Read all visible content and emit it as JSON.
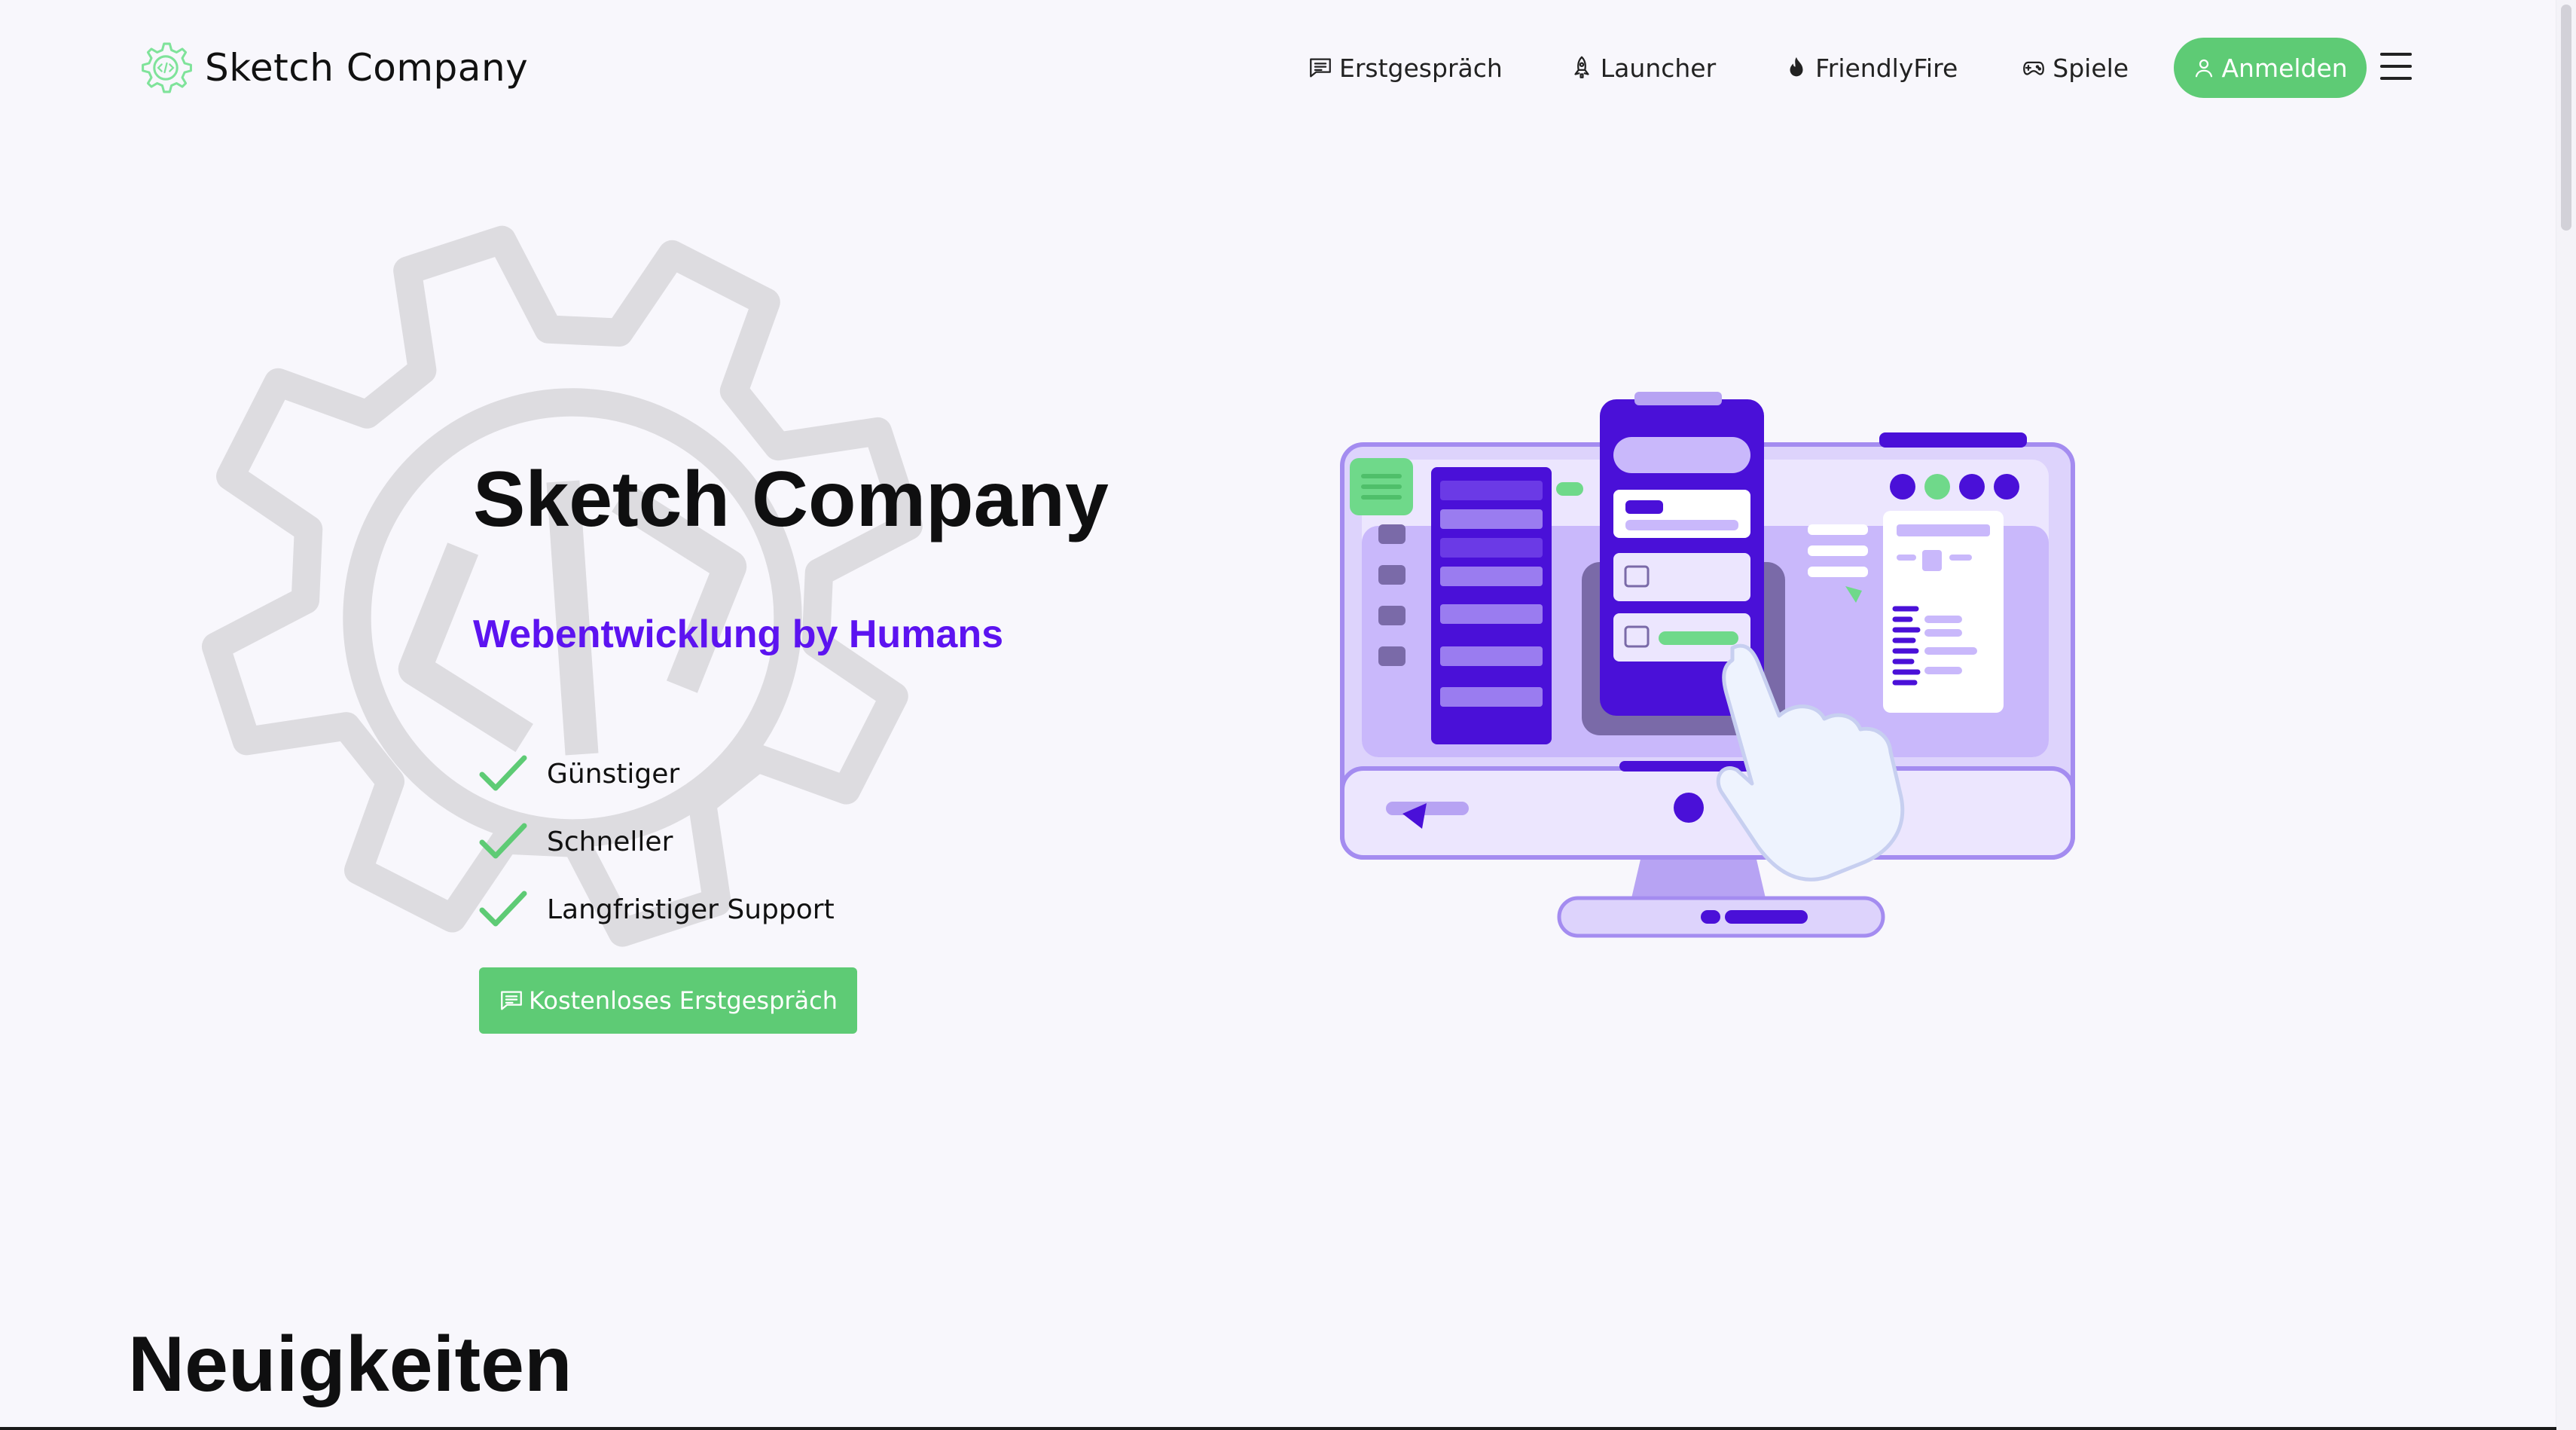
{
  "header": {
    "brand": "Sketch Company",
    "logo_icon": "gear-code-icon",
    "nav": [
      {
        "label": "Erstgespräch",
        "icon": "chat-icon"
      },
      {
        "label": "Launcher",
        "icon": "rocket-icon"
      },
      {
        "label": "FriendlyFire",
        "icon": "flame-icon"
      },
      {
        "label": "Spiele",
        "icon": "gamepad-icon"
      }
    ],
    "login_label": "Anmelden",
    "login_icon": "user-icon",
    "menu_icon": "hamburger-icon"
  },
  "hero": {
    "title": "Sketch Company",
    "subtitle": "Webentwicklung by Humans",
    "features": [
      "Günstiger",
      "Schneller",
      "Langfristiger Support"
    ],
    "cta_label": "Kostenloses Erstgespräch",
    "illustration": "computer-with-hand-illustration"
  },
  "sections": {
    "news_title": "Neuigkeiten"
  },
  "colors": {
    "accent_green": "#5ecb75",
    "accent_purple": "#5c13f0",
    "background": "#f8f7fc"
  }
}
